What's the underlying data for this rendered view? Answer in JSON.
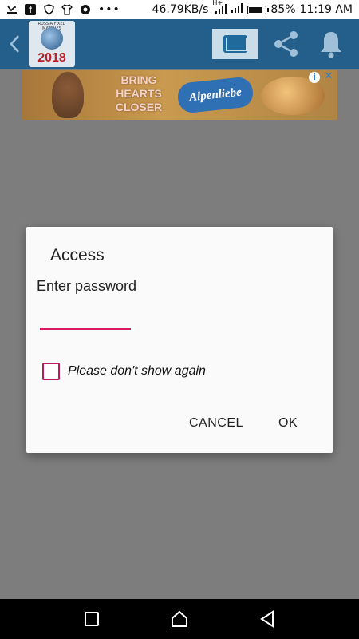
{
  "status_bar": {
    "network_speed": "46.79KB/s",
    "network_type": "H+",
    "battery_percent": "85%",
    "battery_level": 0.85,
    "time": "11:19 AM",
    "icons": [
      "missed-call-icon",
      "facebook-icon",
      "shield-icon",
      "shirt-icon",
      "chrome-icon",
      "more-dots-icon",
      "signal-icon",
      "wifi-signal-icon",
      "battery-icon"
    ]
  },
  "toolbar": {
    "back_icon": "chevron-left-icon",
    "logo_year": "2018",
    "logo_caption": "RUSSIA FIXED MATCHES",
    "actions": [
      "mail-icon",
      "share-icon",
      "bell-icon"
    ],
    "color": "#235f8a"
  },
  "ad": {
    "slogan": [
      "BRING",
      "HEARTS",
      "CLOSER"
    ],
    "brand": "Alpenliebe",
    "info_icon": "info-icon",
    "close_icon": "close-icon"
  },
  "dialog": {
    "title": "Access",
    "message": "Enter password",
    "password_value": "",
    "checkbox_label": "Please don't show again",
    "checkbox_checked": false,
    "cancel_label": "CANCEL",
    "ok_label": "OK",
    "accent_color": "#d81b60"
  },
  "navbar": {
    "buttons": [
      "recent-apps-icon",
      "home-icon",
      "back-triangle-icon"
    ]
  }
}
